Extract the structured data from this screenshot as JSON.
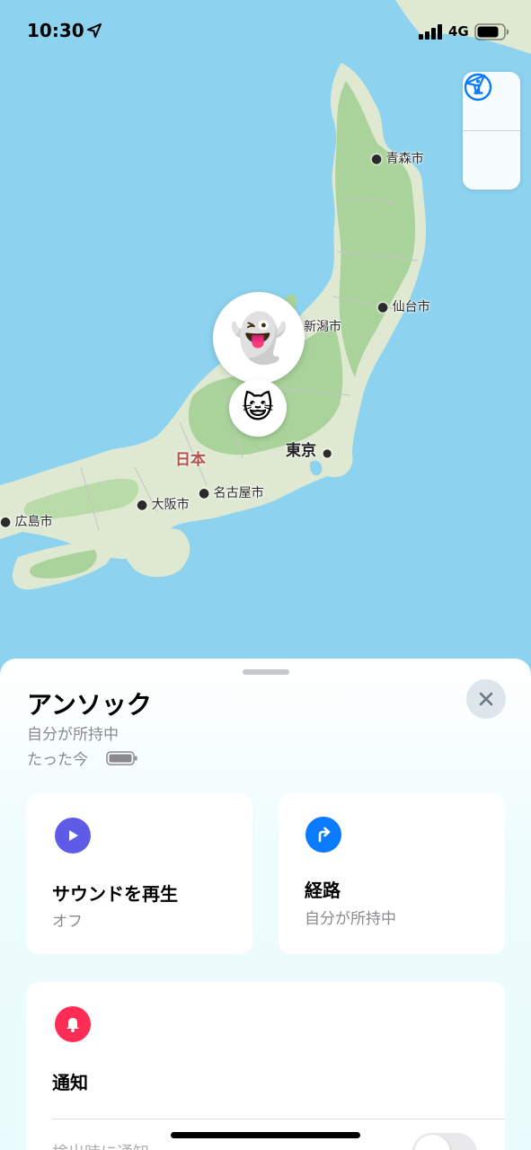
{
  "status_bar": {
    "time": "10:30",
    "network": "4G"
  },
  "map": {
    "country_label": "日本",
    "cities": {
      "aomori": "青森市",
      "sendai": "仙台市",
      "niigata": "新潟市",
      "tokyo": "東京",
      "nagoya": "名古屋市",
      "osaka": "大阪市",
      "hiroshima": "広島市"
    },
    "pins": {
      "primary_emoji": "👻",
      "secondary_emoji": "😺"
    },
    "controls": {
      "info_icon": "info-icon",
      "location_icon": "location-arrow-icon"
    }
  },
  "sheet": {
    "item_name": "アンソック",
    "owner_status": "自分が所持中",
    "last_seen": "たった今",
    "actions": {
      "play_sound": {
        "title": "サウンドを再生",
        "subtitle": "オフ",
        "icon": "play-icon",
        "color": "#5e5ce6"
      },
      "directions": {
        "title": "経路",
        "subtitle": "自分が所持中",
        "icon": "turn-arrow-icon",
        "color": "#0a7aff"
      },
      "notifications": {
        "title": "通知",
        "row_label": "検出時に通知",
        "icon": "bell-icon",
        "color": "#ff2d55"
      }
    }
  },
  "colors": {
    "water": "#8dd3ef",
    "land": "#dfe9d2",
    "forest": "#a9d39a",
    "accent": "#0a7aff"
  }
}
